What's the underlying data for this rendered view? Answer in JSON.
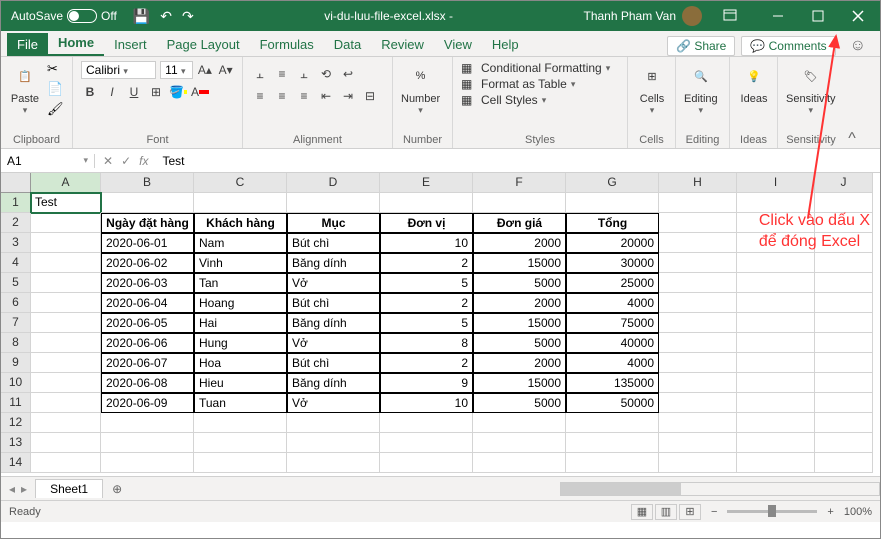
{
  "title_bar": {
    "autosave_label": "AutoSave",
    "autosave_state": "Off",
    "filename": "vi-du-luu-file-excel.xlsx  -",
    "user_name": "Thanh Pham Van"
  },
  "tabs": {
    "file": "File",
    "home": "Home",
    "insert": "Insert",
    "page_layout": "Page Layout",
    "formulas": "Formulas",
    "data": "Data",
    "review": "Review",
    "view": "View",
    "help": "Help",
    "share": "Share",
    "comments": "Comments"
  },
  "ribbon": {
    "paste": "Paste",
    "clipboard": "Clipboard",
    "font_name": "Calibri",
    "font_size": "11",
    "font_group": "Font",
    "alignment": "Alignment",
    "number": "Number",
    "cond_fmt": "Conditional Formatting",
    "fmt_table": "Format as Table",
    "cell_styles": "Cell Styles",
    "styles": "Styles",
    "cells": "Cells",
    "editing": "Editing",
    "ideas": "Ideas",
    "sensitivity": "Sensitivity"
  },
  "formula_bar": {
    "cell_ref": "A1",
    "value": "Test"
  },
  "columns": [
    "A",
    "B",
    "C",
    "D",
    "E",
    "F",
    "G",
    "H",
    "I",
    "J"
  ],
  "rows": [
    "1",
    "2",
    "3",
    "4",
    "5",
    "6",
    "7",
    "8",
    "9",
    "10",
    "11",
    "12",
    "13",
    "14"
  ],
  "a1": "Test",
  "headers": [
    "Ngày đặt hàng",
    "Khách hàng",
    "Mục",
    "Đơn vị",
    "Đơn giá",
    "Tổng"
  ],
  "data_rows": [
    [
      "2020-06-01",
      "Nam",
      "Bút chì",
      "10",
      "2000",
      "20000"
    ],
    [
      "2020-06-02",
      "Vinh",
      "Băng dính",
      "2",
      "15000",
      "30000"
    ],
    [
      "2020-06-03",
      "Tan",
      "Vở",
      "5",
      "5000",
      "25000"
    ],
    [
      "2020-06-04",
      "Hoang",
      "Bút chì",
      "2",
      "2000",
      "4000"
    ],
    [
      "2020-06-05",
      "Hai",
      "Băng dính",
      "5",
      "15000",
      "75000"
    ],
    [
      "2020-06-06",
      "Hung",
      "Vở",
      "8",
      "5000",
      "40000"
    ],
    [
      "2020-06-07",
      "Hoa",
      "Bút chì",
      "2",
      "2000",
      "4000"
    ],
    [
      "2020-06-08",
      "Hieu",
      "Băng dính",
      "9",
      "15000",
      "135000"
    ],
    [
      "2020-06-09",
      "Tuan",
      "Vở",
      "10",
      "5000",
      "50000"
    ]
  ],
  "annotation": {
    "line1": "Click vào dấu X",
    "line2": "để đóng Excel"
  },
  "sheet_tab": "Sheet1",
  "status": {
    "ready": "Ready",
    "zoom": "100%"
  }
}
